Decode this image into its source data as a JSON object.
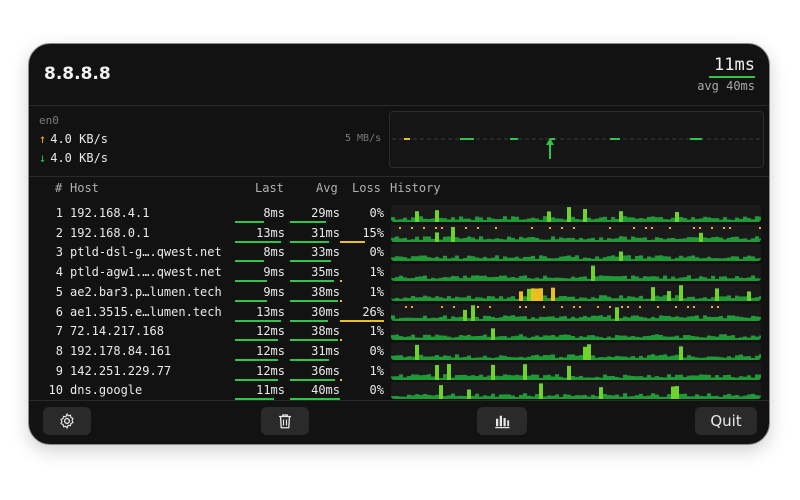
{
  "header": {
    "target": "8.8.8.8",
    "last": "11ms",
    "avg": "avg 40ms"
  },
  "network": {
    "interface": "en0",
    "upload": "4.0 KB/s",
    "download": "4.0 KB/s",
    "scale": "5 MB/s"
  },
  "columns": {
    "idx": "#",
    "host": "Host",
    "last": "Last",
    "avg": "Avg",
    "loss": "Loss",
    "history": "History"
  },
  "hops": [
    {
      "idx": "1",
      "host": "192.168.4.1",
      "last": "8ms",
      "avg": "29ms",
      "loss": "0%"
    },
    {
      "idx": "2",
      "host": "192.168.0.1",
      "last": "13ms",
      "avg": "31ms",
      "loss": "15%"
    },
    {
      "idx": "3",
      "host": "ptld-dsl-g….qwest.net",
      "last": "8ms",
      "avg": "33ms",
      "loss": "0%"
    },
    {
      "idx": "4",
      "host": "ptld-agw1.….qwest.net",
      "last": "9ms",
      "avg": "35ms",
      "loss": "1%"
    },
    {
      "idx": "5",
      "host": "ae2.bar3.p…lumen.tech",
      "last": "9ms",
      "avg": "38ms",
      "loss": "1%"
    },
    {
      "idx": "6",
      "host": "ae1.3515.e…lumen.tech",
      "last": "13ms",
      "avg": "30ms",
      "loss": "26%"
    },
    {
      "idx": "7",
      "host": "72.14.217.168",
      "last": "12ms",
      "avg": "38ms",
      "loss": "1%"
    },
    {
      "idx": "8",
      "host": "192.178.84.161",
      "last": "12ms",
      "avg": "31ms",
      "loss": "0%"
    },
    {
      "idx": "9",
      "host": "142.251.229.77",
      "last": "12ms",
      "avg": "36ms",
      "loss": "1%"
    },
    {
      "idx": "10",
      "host": "dns.google",
      "last": "11ms",
      "avg": "40ms",
      "loss": "0%"
    }
  ],
  "toolbar": {
    "settings_icon": "gear-icon",
    "clear_icon": "trash-icon",
    "chart_icon": "bar-chart-icon",
    "quit_label": "Quit"
  },
  "colors": {
    "background": "#121212",
    "good": "#2fc44a",
    "warn": "#e8c020",
    "bad": "#f0b020"
  }
}
